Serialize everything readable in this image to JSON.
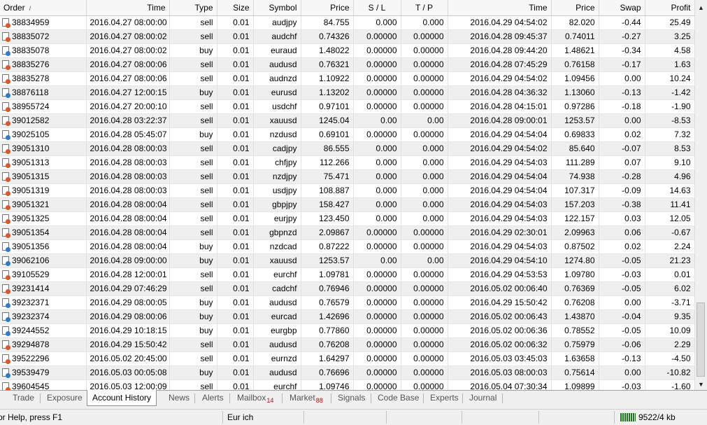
{
  "columns": {
    "order": "Order",
    "time": "Time",
    "type": "Type",
    "size": "Size",
    "symbol": "Symbol",
    "price": "Price",
    "sl": "S / L",
    "tp": "T / P",
    "close_time": "Time",
    "close_price": "Price",
    "swap": "Swap",
    "profit": "Profit"
  },
  "sort_indicator": "/",
  "rows": [
    {
      "order": "38834959",
      "time": "2016.04.27 08:00:00",
      "type": "sell",
      "size": "0.01",
      "symbol": "audjpy",
      "price": "84.755",
      "sl": "0.000",
      "tp": "0.000",
      "close_time": "2016.04.29 04:54:02",
      "close_price": "82.020",
      "swap": "-0.44",
      "profit": "25.49"
    },
    {
      "order": "38835072",
      "time": "2016.04.27 08:00:02",
      "type": "sell",
      "size": "0.01",
      "symbol": "audchf",
      "price": "0.74326",
      "sl": "0.00000",
      "tp": "0.00000",
      "close_time": "2016.04.28 09:45:37",
      "close_price": "0.74011",
      "swap": "-0.27",
      "profit": "3.25"
    },
    {
      "order": "38835078",
      "time": "2016.04.27 08:00:02",
      "type": "buy",
      "size": "0.01",
      "symbol": "euraud",
      "price": "1.48022",
      "sl": "0.00000",
      "tp": "0.00000",
      "close_time": "2016.04.28 09:44:20",
      "close_price": "1.48621",
      "swap": "-0.34",
      "profit": "4.58"
    },
    {
      "order": "38835276",
      "time": "2016.04.27 08:00:06",
      "type": "sell",
      "size": "0.01",
      "symbol": "audusd",
      "price": "0.76321",
      "sl": "0.00000",
      "tp": "0.00000",
      "close_time": "2016.04.28 07:45:29",
      "close_price": "0.76158",
      "swap": "-0.17",
      "profit": "1.63"
    },
    {
      "order": "38835278",
      "time": "2016.04.27 08:00:06",
      "type": "sell",
      "size": "0.01",
      "symbol": "audnzd",
      "price": "1.10922",
      "sl": "0.00000",
      "tp": "0.00000",
      "close_time": "2016.04.29 04:54:02",
      "close_price": "1.09456",
      "swap": "0.00",
      "profit": "10.24"
    },
    {
      "order": "38876118",
      "time": "2016.04.27 12:00:15",
      "type": "buy",
      "size": "0.01",
      "symbol": "eurusd",
      "price": "1.13202",
      "sl": "0.00000",
      "tp": "0.00000",
      "close_time": "2016.04.28 04:36:32",
      "close_price": "1.13060",
      "swap": "-0.13",
      "profit": "-1.42"
    },
    {
      "order": "38955724",
      "time": "2016.04.27 20:00:10",
      "type": "sell",
      "size": "0.01",
      "symbol": "usdchf",
      "price": "0.97101",
      "sl": "0.00000",
      "tp": "0.00000",
      "close_time": "2016.04.28 04:15:01",
      "close_price": "0.97286",
      "swap": "-0.18",
      "profit": "-1.90"
    },
    {
      "order": "39012582",
      "time": "2016.04.28 03:22:37",
      "type": "sell",
      "size": "0.01",
      "symbol": "xauusd",
      "price": "1245.04",
      "sl": "0.00",
      "tp": "0.00",
      "close_time": "2016.04.28 09:00:01",
      "close_price": "1253.57",
      "swap": "0.00",
      "profit": "-8.53"
    },
    {
      "order": "39025105",
      "time": "2016.04.28 05:45:07",
      "type": "buy",
      "size": "0.01",
      "symbol": "nzdusd",
      "price": "0.69101",
      "sl": "0.00000",
      "tp": "0.00000",
      "close_time": "2016.04.29 04:54:04",
      "close_price": "0.69833",
      "swap": "0.02",
      "profit": "7.32"
    },
    {
      "order": "39051310",
      "time": "2016.04.28 08:00:03",
      "type": "sell",
      "size": "0.01",
      "symbol": "cadjpy",
      "price": "86.555",
      "sl": "0.000",
      "tp": "0.000",
      "close_time": "2016.04.29 04:54:02",
      "close_price": "85.640",
      "swap": "-0.07",
      "profit": "8.53"
    },
    {
      "order": "39051313",
      "time": "2016.04.28 08:00:03",
      "type": "sell",
      "size": "0.01",
      "symbol": "chfjpy",
      "price": "112.266",
      "sl": "0.000",
      "tp": "0.000",
      "close_time": "2016.04.29 04:54:03",
      "close_price": "111.289",
      "swap": "0.07",
      "profit": "9.10"
    },
    {
      "order": "39051315",
      "time": "2016.04.28 08:00:03",
      "type": "sell",
      "size": "0.01",
      "symbol": "nzdjpy",
      "price": "75.471",
      "sl": "0.000",
      "tp": "0.000",
      "close_time": "2016.04.29 04:54:04",
      "close_price": "74.938",
      "swap": "-0.28",
      "profit": "4.96"
    },
    {
      "order": "39051319",
      "time": "2016.04.28 08:00:03",
      "type": "sell",
      "size": "0.01",
      "symbol": "usdjpy",
      "price": "108.887",
      "sl": "0.000",
      "tp": "0.000",
      "close_time": "2016.04.29 04:54:04",
      "close_price": "107.317",
      "swap": "-0.09",
      "profit": "14.63"
    },
    {
      "order": "39051321",
      "time": "2016.04.28 08:00:04",
      "type": "sell",
      "size": "0.01",
      "symbol": "gbpjpy",
      "price": "158.427",
      "sl": "0.000",
      "tp": "0.000",
      "close_time": "2016.04.29 04:54:03",
      "close_price": "157.203",
      "swap": "-0.38",
      "profit": "11.41"
    },
    {
      "order": "39051325",
      "time": "2016.04.28 08:00:04",
      "type": "sell",
      "size": "0.01",
      "symbol": "eurjpy",
      "price": "123.450",
      "sl": "0.000",
      "tp": "0.000",
      "close_time": "2016.04.29 04:54:03",
      "close_price": "122.157",
      "swap": "0.03",
      "profit": "12.05"
    },
    {
      "order": "39051354",
      "time": "2016.04.28 08:00:04",
      "type": "sell",
      "size": "0.01",
      "symbol": "gbpnzd",
      "price": "2.09867",
      "sl": "0.00000",
      "tp": "0.00000",
      "close_time": "2016.04.29 02:30:01",
      "close_price": "2.09963",
      "swap": "0.06",
      "profit": "-0.67"
    },
    {
      "order": "39051356",
      "time": "2016.04.28 08:00:04",
      "type": "buy",
      "size": "0.01",
      "symbol": "nzdcad",
      "price": "0.87222",
      "sl": "0.00000",
      "tp": "0.00000",
      "close_time": "2016.04.29 04:54:03",
      "close_price": "0.87502",
      "swap": "0.02",
      "profit": "2.24"
    },
    {
      "order": "39062106",
      "time": "2016.04.28 09:00:00",
      "type": "buy",
      "size": "0.01",
      "symbol": "xauusd",
      "price": "1253.57",
      "sl": "0.00",
      "tp": "0.00",
      "close_time": "2016.04.29 04:54:10",
      "close_price": "1274.80",
      "swap": "-0.05",
      "profit": "21.23"
    },
    {
      "order": "39105529",
      "time": "2016.04.28 12:00:01",
      "type": "sell",
      "size": "0.01",
      "symbol": "eurchf",
      "price": "1.09781",
      "sl": "0.00000",
      "tp": "0.00000",
      "close_time": "2016.04.29 04:53:53",
      "close_price": "1.09780",
      "swap": "-0.03",
      "profit": "0.01"
    },
    {
      "order": "39231414",
      "time": "2016.04.29 07:46:29",
      "type": "sell",
      "size": "0.01",
      "symbol": "cadchf",
      "price": "0.76946",
      "sl": "0.00000",
      "tp": "0.00000",
      "close_time": "2016.05.02 00:06:40",
      "close_price": "0.76369",
      "swap": "-0.05",
      "profit": "6.02"
    },
    {
      "order": "39232371",
      "time": "2016.04.29 08:00:05",
      "type": "buy",
      "size": "0.01",
      "symbol": "audusd",
      "price": "0.76579",
      "sl": "0.00000",
      "tp": "0.00000",
      "close_time": "2016.04.29 15:50:42",
      "close_price": "0.76208",
      "swap": "0.00",
      "profit": "-3.71"
    },
    {
      "order": "39232374",
      "time": "2016.04.29 08:00:06",
      "type": "buy",
      "size": "0.01",
      "symbol": "eurcad",
      "price": "1.42696",
      "sl": "0.00000",
      "tp": "0.00000",
      "close_time": "2016.05.02 00:06:43",
      "close_price": "1.43870",
      "swap": "-0.04",
      "profit": "9.35"
    },
    {
      "order": "39244552",
      "time": "2016.04.29 10:18:15",
      "type": "buy",
      "size": "0.01",
      "symbol": "eurgbp",
      "price": "0.77860",
      "sl": "0.00000",
      "tp": "0.00000",
      "close_time": "2016.05.02 00:06:36",
      "close_price": "0.78552",
      "swap": "-0.05",
      "profit": "10.09"
    },
    {
      "order": "39294878",
      "time": "2016.04.29 15:50:42",
      "type": "sell",
      "size": "0.01",
      "symbol": "audusd",
      "price": "0.76208",
      "sl": "0.00000",
      "tp": "0.00000",
      "close_time": "2016.05.02 00:06:32",
      "close_price": "0.75979",
      "swap": "-0.06",
      "profit": "2.29"
    },
    {
      "order": "39522296",
      "time": "2016.05.02 20:45:00",
      "type": "sell",
      "size": "0.01",
      "symbol": "eurnzd",
      "price": "1.64297",
      "sl": "0.00000",
      "tp": "0.00000",
      "close_time": "2016.05.03 03:45:03",
      "close_price": "1.63658",
      "swap": "-0.13",
      "profit": "-4.50"
    },
    {
      "order": "39539479",
      "time": "2016.05.03 00:05:08",
      "type": "buy",
      "size": "0.01",
      "symbol": "audusd",
      "price": "0.76696",
      "sl": "0.00000",
      "tp": "0.00000",
      "close_time": "2016.05.03 08:00:03",
      "close_price": "0.75614",
      "swap": "0.00",
      "profit": "-10.82"
    },
    {
      "order": "39604545",
      "time": "2016.05.03 12:00:09",
      "type": "sell",
      "size": "0.01",
      "symbol": "eurchf",
      "price": "1.09746",
      "sl": "0.00000",
      "tp": "0.00000",
      "close_time": "2016.05.04 07:30:34",
      "close_price": "1.09899",
      "swap": "-0.03",
      "profit": "-1.60"
    }
  ],
  "scrollbar": {
    "up": "▲",
    "down": "▼"
  },
  "tabs": [
    {
      "label": "Trade",
      "badge": ""
    },
    {
      "label": "Exposure",
      "badge": ""
    },
    {
      "label": "Account History",
      "badge": "",
      "active": true
    },
    {
      "label": "News",
      "badge": ""
    },
    {
      "label": "Alerts",
      "badge": ""
    },
    {
      "label": "Mailbox",
      "badge": "14"
    },
    {
      "label": "Market",
      "badge": "88"
    },
    {
      "label": "Signals",
      "badge": ""
    },
    {
      "label": "Code Base",
      "badge": ""
    },
    {
      "label": "Experts",
      "badge": ""
    },
    {
      "label": "Journal",
      "badge": ""
    }
  ],
  "statusbar": {
    "help": "or Help, press F1",
    "profile": "Eur ich",
    "traffic": "9522/4 kb"
  },
  "colors": {
    "sell_icon": "#e25522",
    "buy_icon": "#2a7bd6",
    "badge": "#d00000",
    "traffic_bars": "#1a7a1a"
  }
}
